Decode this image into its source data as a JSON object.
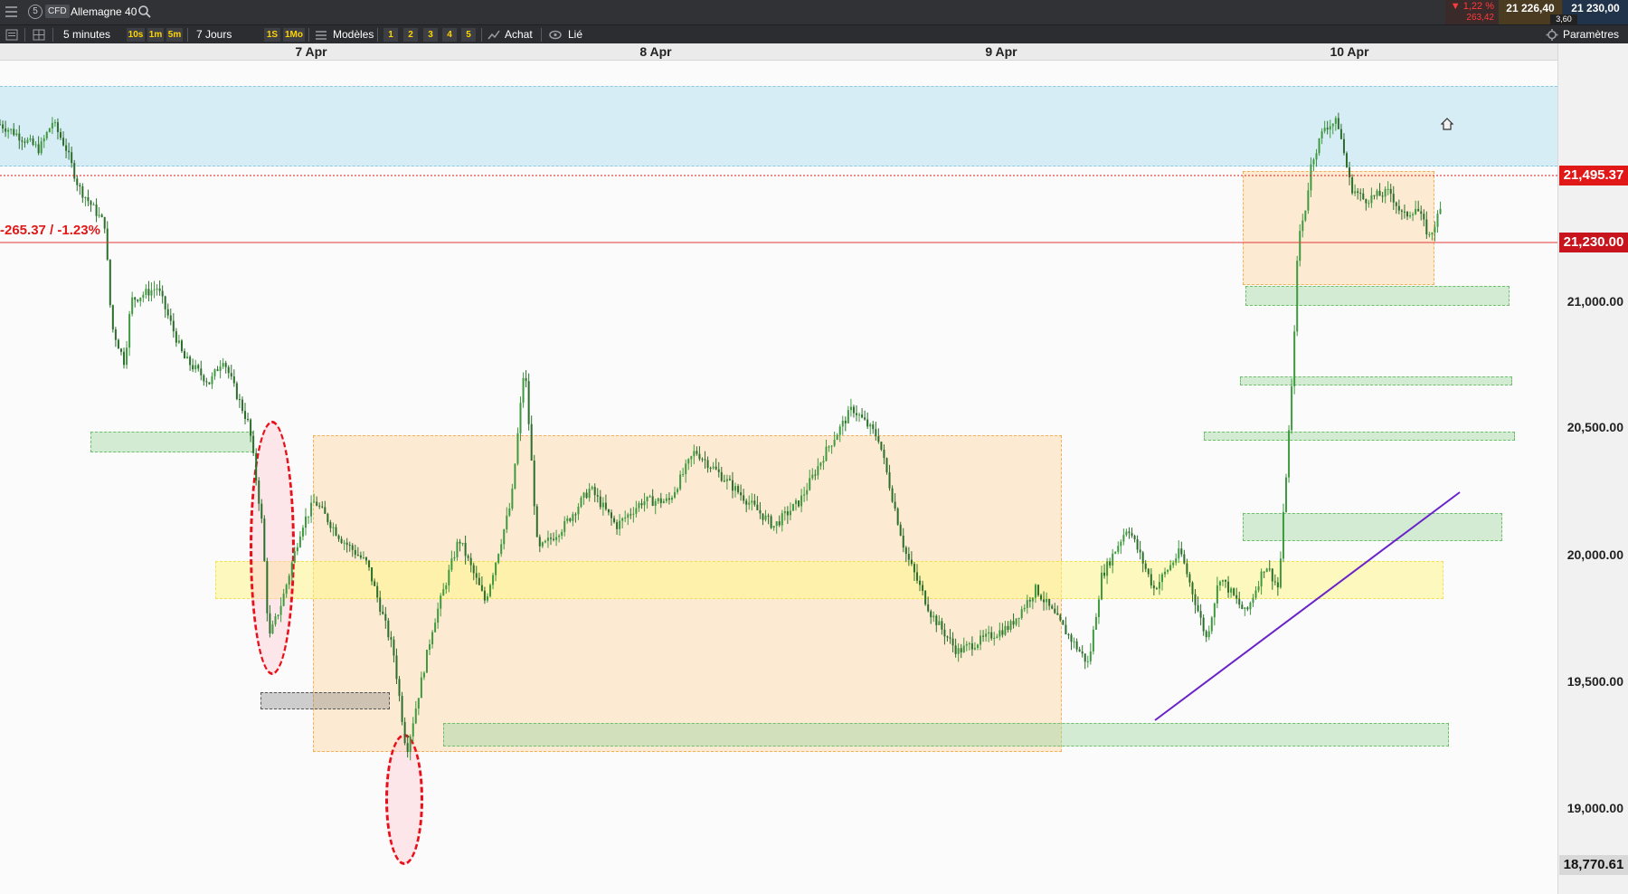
{
  "topbar": {
    "menu_icon": "hamburger-icon",
    "workspace_number": "5",
    "product_type": "CFD",
    "instrument": "Allemagne 40",
    "search_icon": "search-icon",
    "change_pct": "▼ 1,22 %",
    "change_pts": "263,42",
    "bid": "21 226,40",
    "ask": "21 230,00",
    "spread": "3,60"
  },
  "toolbar": {
    "timeframe": "5 minutes",
    "quick_intervals": [
      "10s",
      "1m",
      "5m"
    ],
    "range": "7 Jours",
    "quick_ranges": [
      "1S",
      "1Mo"
    ],
    "templates": "Modèles",
    "layouts": [
      "1",
      "2",
      "3",
      "4",
      "5"
    ],
    "order": "Achat",
    "linked": "Lié",
    "settings": "Paramètres"
  },
  "chart_data": {
    "type": "candlestick",
    "x_labels": [
      "7 Apr",
      "8 Apr",
      "9 Apr",
      "10 Apr"
    ],
    "y_ticks": [
      "21,000.00",
      "20,500.00",
      "20,000.00",
      "19,500.00",
      "19,000.00"
    ],
    "y_range": [
      18720,
      21750
    ],
    "last_price": "21,230.00",
    "reference_price": "21,495.37",
    "low_marker": "18,770.61",
    "change_label": "-265.37 / -1.23%",
    "price_path": [
      [
        0,
        21550
      ],
      [
        0.01,
        21520
      ],
      [
        0.03,
        21450
      ],
      [
        0.04,
        21560
      ],
      [
        0.05,
        21460
      ],
      [
        0.06,
        21300
      ],
      [
        0.08,
        21150
      ],
      [
        0.085,
        20750
      ],
      [
        0.095,
        20600
      ],
      [
        0.1,
        20850
      ],
      [
        0.12,
        20900
      ],
      [
        0.14,
        20620
      ],
      [
        0.16,
        20520
      ],
      [
        0.17,
        20620
      ],
      [
        0.18,
        20480
      ],
      [
        0.19,
        20350
      ],
      [
        0.2,
        19950
      ],
      [
        0.205,
        19500
      ],
      [
        0.215,
        19650
      ],
      [
        0.23,
        19950
      ],
      [
        0.24,
        20050
      ],
      [
        0.26,
        19900
      ],
      [
        0.28,
        19800
      ],
      [
        0.3,
        19450
      ],
      [
        0.31,
        19050
      ],
      [
        0.32,
        19300
      ],
      [
        0.33,
        19550
      ],
      [
        0.35,
        19900
      ],
      [
        0.37,
        19650
      ],
      [
        0.39,
        20050
      ],
      [
        0.4,
        20600
      ],
      [
        0.41,
        19850
      ],
      [
        0.43,
        19950
      ],
      [
        0.45,
        20100
      ],
      [
        0.47,
        19950
      ],
      [
        0.49,
        20050
      ],
      [
        0.51,
        20050
      ],
      [
        0.53,
        20250
      ],
      [
        0.55,
        20150
      ],
      [
        0.57,
        20050
      ],
      [
        0.59,
        19950
      ],
      [
        0.61,
        20050
      ],
      [
        0.63,
        20250
      ],
      [
        0.65,
        20420
      ],
      [
        0.67,
        20300
      ],
      [
        0.69,
        19850
      ],
      [
        0.71,
        19600
      ],
      [
        0.73,
        19450
      ],
      [
        0.75,
        19500
      ],
      [
        0.77,
        19550
      ],
      [
        0.79,
        19700
      ],
      [
        0.81,
        19550
      ],
      [
        0.83,
        19400
      ],
      [
        0.84,
        19750
      ],
      [
        0.86,
        19950
      ],
      [
        0.88,
        19700
      ],
      [
        0.9,
        19850
      ],
      [
        0.92,
        19500
      ],
      [
        0.93,
        19750
      ],
      [
        0.95,
        19600
      ],
      [
        0.965,
        19800
      ],
      [
        0.975,
        19700
      ],
      [
        0.985,
        20500
      ],
      [
        0.99,
        21100
      ],
      [
        0.995,
        21200
      ],
      [
        1.0,
        21400
      ],
      [
        1.01,
        21540
      ],
      [
        1.02,
        21560
      ],
      [
        1.03,
        21300
      ],
      [
        1.04,
        21250
      ],
      [
        1.06,
        21280
      ],
      [
        1.07,
        21180
      ],
      [
        1.08,
        21220
      ],
      [
        1.09,
        21100
      ],
      [
        1.1,
        21230
      ]
    ],
    "annotations": {
      "zones": "supply/demand rectangles",
      "trendline_color": "#6a22c9",
      "highlight_color": "#e8101a"
    }
  },
  "colors": {
    "candle": "#3f9a3f",
    "last_price_tag": "#c8141c",
    "reference_tag": "#e01818"
  }
}
